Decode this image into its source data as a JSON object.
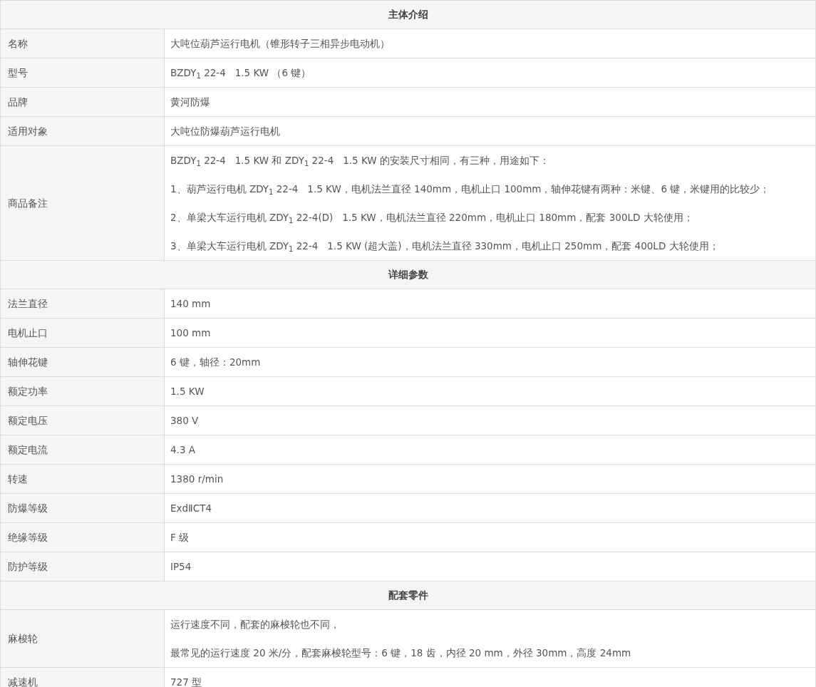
{
  "sections": [
    {
      "title": "主体介绍",
      "rows": [
        {
          "label": "名称",
          "lines": [
            "大吨位葫芦运行电机（锥形转子三相异步电动机）"
          ]
        },
        {
          "label": "型号",
          "lines": [
            "BZDY$_{1}$ 22-4   1.5 KW （6 键）"
          ]
        },
        {
          "label": "品牌",
          "lines": [
            "黄河防爆"
          ]
        },
        {
          "label": "适用对象",
          "lines": [
            "大吨位防爆葫芦运行电机"
          ]
        },
        {
          "label": "商品备注",
          "lines": [
            "BZDY$_{1}$ 22-4   1.5 KW 和 ZDY$_{1}$ 22-4   1.5 KW 的安装尺寸相同，有三种，用途如下：",
            "1、葫芦运行电机 ZDY$_{1}$ 22-4   1.5 KW，电机法兰直径 140mm，电机止口 100mm，轴伸花键有两种：米键、6 键，米键用的比较少；",
            "2、单梁大车运行电机 ZDY$_{1}$ 22-4(D)   1.5 KW，电机法兰直径 220mm，电机止口 180mm，配套 300LD 大轮使用；",
            "3、单梁大车运行电机 ZDY$_{1}$ 22-4   1.5 KW (超大盖)，电机法兰直径 330mm，电机止口 250mm，配套 400LD 大轮使用；"
          ]
        }
      ]
    },
    {
      "title": "详细参数",
      "rows": [
        {
          "label": "法兰直径",
          "lines": [
            "140 mm"
          ]
        },
        {
          "label": "电机止口",
          "lines": [
            "100 mm"
          ]
        },
        {
          "label": "轴伸花键",
          "lines": [
            "6 键，轴径：20mm"
          ]
        },
        {
          "label": "额定功率",
          "lines": [
            "1.5 KW"
          ]
        },
        {
          "label": "额定电压",
          "lines": [
            "380 V"
          ]
        },
        {
          "label": "额定电流",
          "lines": [
            "4.3 A"
          ]
        },
        {
          "label": "转速",
          "lines": [
            "1380 r/min"
          ]
        },
        {
          "label": "防爆等级",
          "lines": [
            "ExdⅡCT4"
          ]
        },
        {
          "label": "绝缘等级",
          "lines": [
            "F 级"
          ]
        },
        {
          "label": "防护等级",
          "lines": [
            "IP54"
          ]
        }
      ]
    },
    {
      "title": "配套零件",
      "rows": [
        {
          "label": "麻梭轮",
          "lines": [
            "运行速度不同，配套的麻梭轮也不同，",
            "最常见的运行速度 20 米/分，配套麻梭轮型号：6 键，18 齿，内径 20 mm，外径 30mm，高度 24mm"
          ]
        },
        {
          "label": "减速机",
          "lines": [
            "727 型"
          ]
        }
      ]
    }
  ]
}
